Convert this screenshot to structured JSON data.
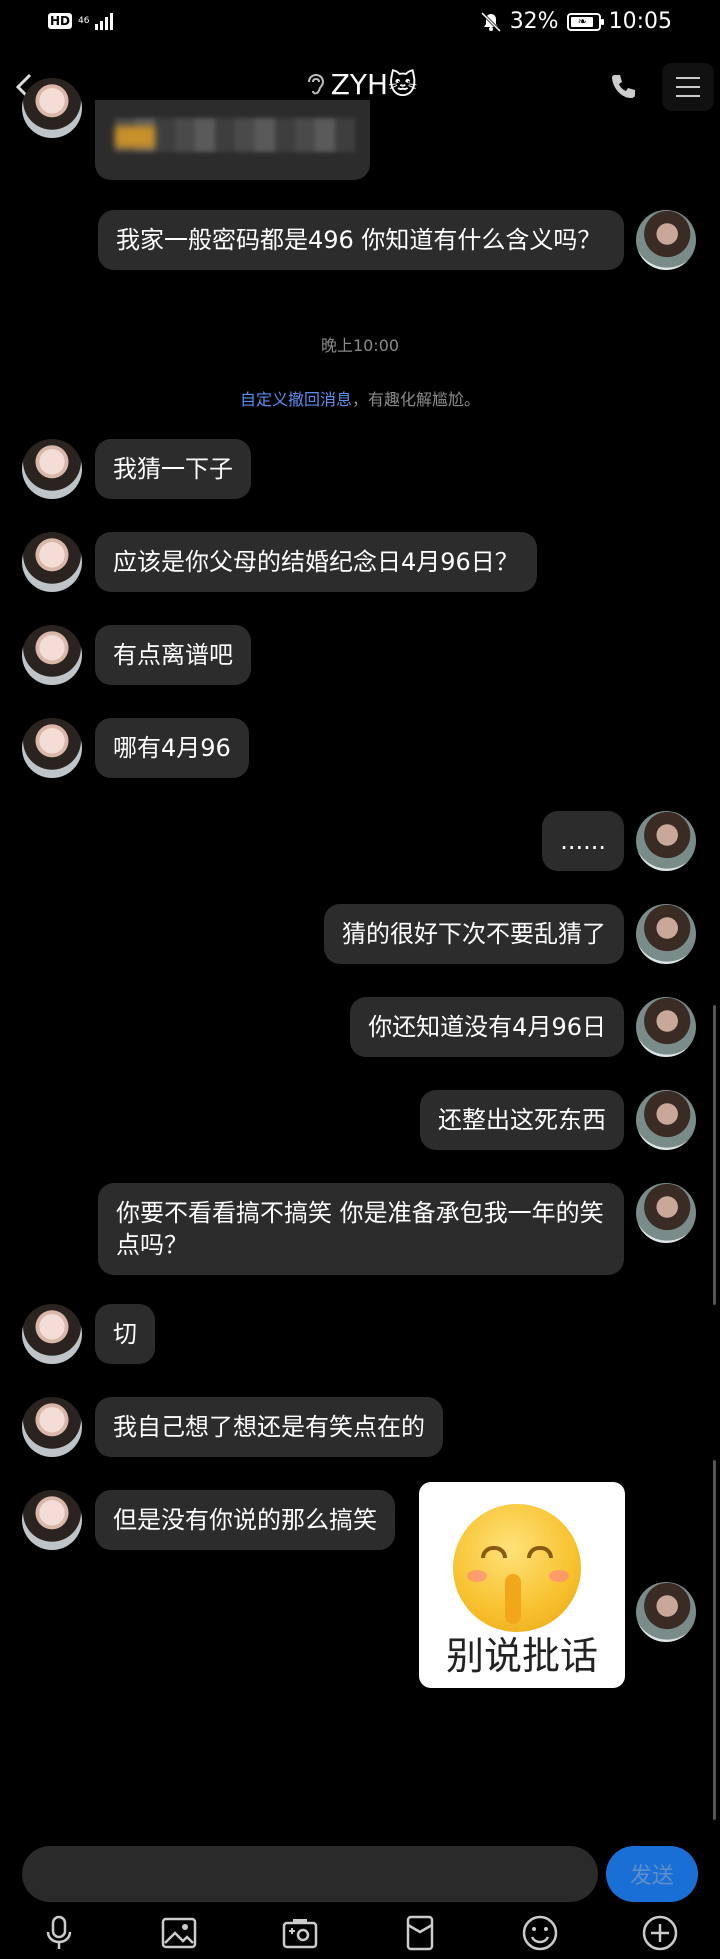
{
  "status_bar": {
    "hd": "HD",
    "network": "46",
    "battery": "32%",
    "time": "10:05"
  },
  "header": {
    "title": "ZYH🐱"
  },
  "messages": {
    "m1": "我家一般密码都是496 你知道有什么含义吗？",
    "timestamp": "晚上10:00",
    "notice_link": "自定义撤回消息",
    "notice_rest": "，有趣化解尴尬。",
    "m2": "我猜一下子",
    "m3": "应该是你父母的结婚纪念日4月96日？",
    "m4": "有点离谱吧",
    "m5": "哪有4月96",
    "m6": "......",
    "m7": "猜的很好下次不要乱猜了",
    "m8": "你还知道没有4月96日",
    "m9": "还整出这死东西",
    "m10": "你要不看看搞不搞笑 你是准备承包我一年的笑点吗？",
    "m11": "切",
    "m12": "我自己想了想还是有笑点在的",
    "m13": "但是没有你说的那么搞笑",
    "sticker_caption": "别说批话"
  },
  "input": {
    "placeholder": "",
    "send_label": "发送"
  },
  "icons": {
    "toolbar": [
      "microphone-icon",
      "image-icon",
      "camera-icon",
      "red-packet-icon",
      "emoji-icon",
      "plus-icon"
    ]
  }
}
